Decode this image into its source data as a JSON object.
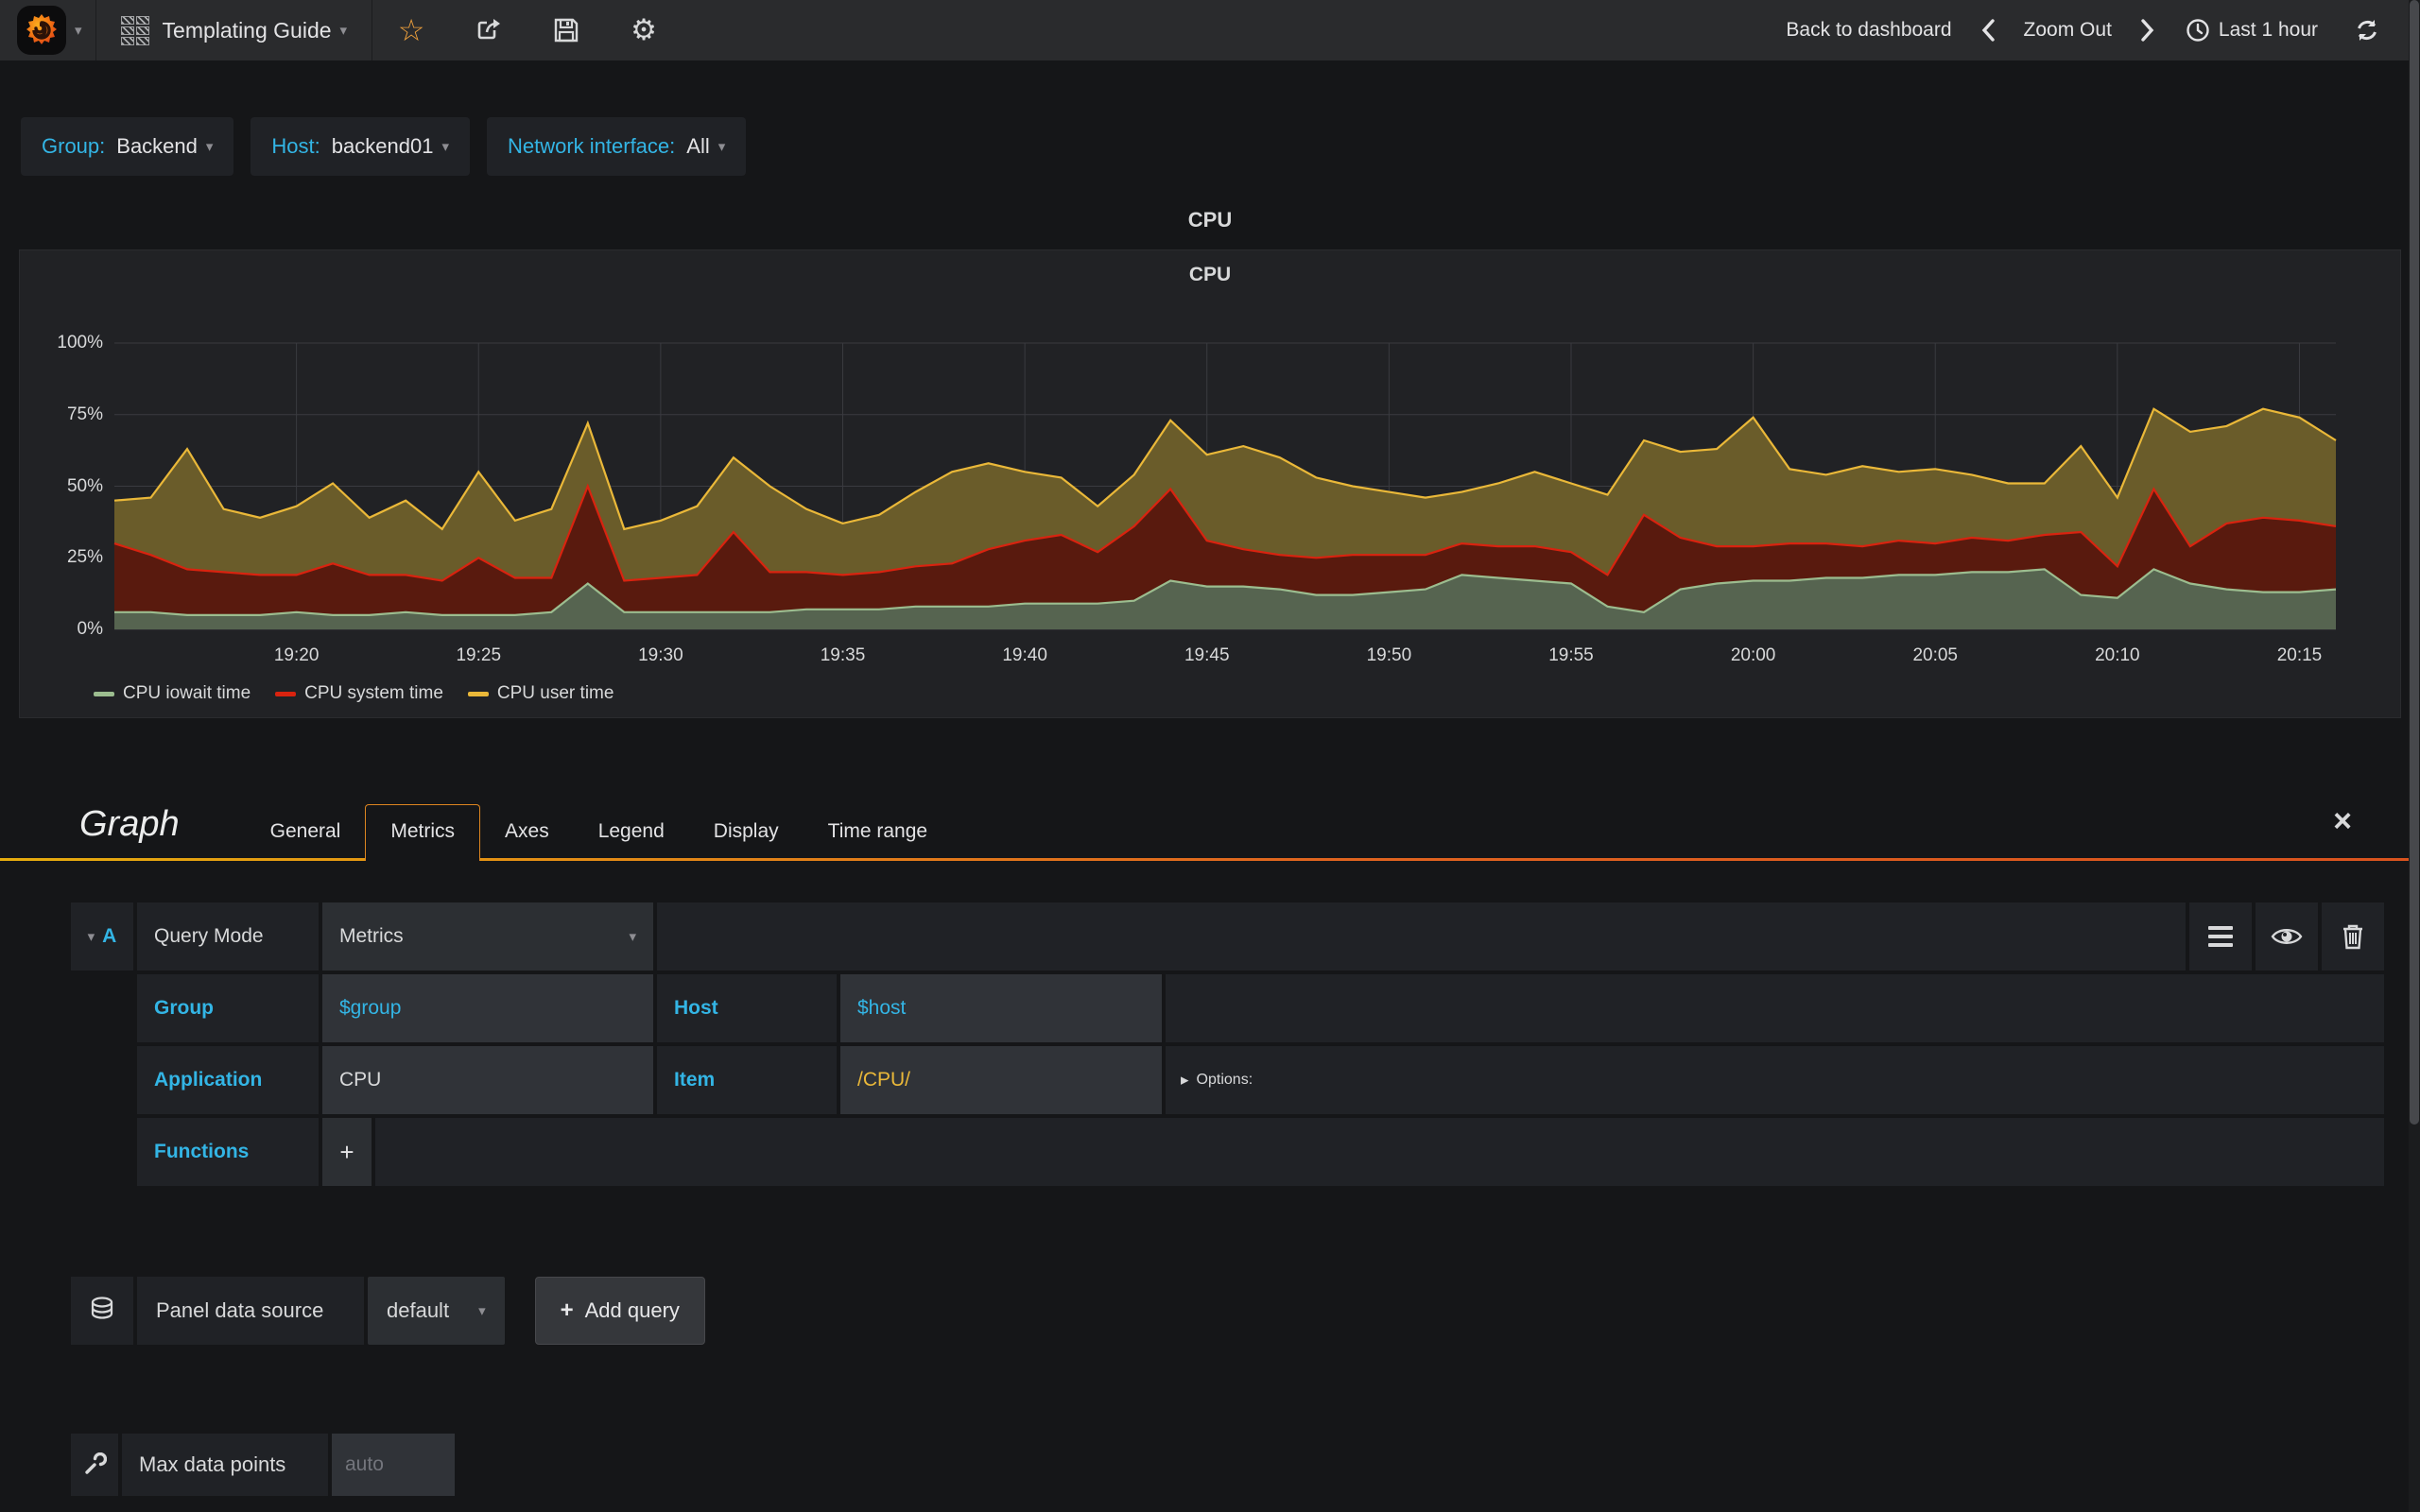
{
  "navbar": {
    "dashboard_title": "Templating Guide",
    "back_to_dashboard": "Back to dashboard",
    "zoom_out": "Zoom Out",
    "time_range": "Last 1 hour"
  },
  "icons": {
    "star": "☆",
    "gear": "⚙",
    "caret_down": "▾",
    "options_caret": "▸",
    "close": "×",
    "plus": "+"
  },
  "variables": [
    {
      "label": "Group:",
      "value": "Backend"
    },
    {
      "label": "Host:",
      "value": "backend01"
    },
    {
      "label": "Network interface:",
      "value": "All"
    }
  ],
  "row_title": "CPU",
  "panel": {
    "title": "CPU"
  },
  "chart_data": {
    "type": "area",
    "stacked": true,
    "title": "CPU",
    "ylabel": "",
    "xlabel": "",
    "ylim": [
      0,
      100
    ],
    "y_ticks": [
      "100%",
      "75%",
      "50%",
      "25%",
      "0%"
    ],
    "grid": true,
    "legend_position": "bottom-left",
    "x": [
      "19:15",
      "19:16",
      "19:17",
      "19:18",
      "19:19",
      "19:20",
      "19:21",
      "19:22",
      "19:23",
      "19:24",
      "19:25",
      "19:26",
      "19:27",
      "19:28",
      "19:29",
      "19:30",
      "19:31",
      "19:32",
      "19:33",
      "19:34",
      "19:35",
      "19:36",
      "19:37",
      "19:38",
      "19:39",
      "19:40",
      "19:41",
      "19:42",
      "19:43",
      "19:44",
      "19:45",
      "19:46",
      "19:47",
      "19:48",
      "19:49",
      "19:50",
      "19:51",
      "19:52",
      "19:53",
      "19:54",
      "19:55",
      "19:56",
      "19:57",
      "19:58",
      "19:59",
      "20:00",
      "20:01",
      "20:02",
      "20:03",
      "20:04",
      "20:05",
      "20:06",
      "20:07",
      "20:08",
      "20:09",
      "20:10",
      "20:11",
      "20:12",
      "20:13",
      "20:14",
      "20:15",
      "20:16"
    ],
    "x_tick_labels": [
      "19:20",
      "19:25",
      "19:30",
      "19:35",
      "19:40",
      "19:45",
      "19:50",
      "19:55",
      "20:00",
      "20:05",
      "20:10",
      "20:15"
    ],
    "x_tick_indices": [
      5,
      10,
      15,
      20,
      25,
      30,
      35,
      40,
      45,
      50,
      55,
      60
    ],
    "series": [
      {
        "name": "CPU iowait time",
        "color": "#9cbd8f",
        "fill": "#566450",
        "values": [
          6,
          6,
          5,
          5,
          5,
          6,
          5,
          5,
          6,
          5,
          5,
          5,
          6,
          16,
          6,
          6,
          6,
          6,
          6,
          7,
          7,
          7,
          8,
          8,
          8,
          9,
          9,
          9,
          10,
          17,
          15,
          15,
          14,
          12,
          12,
          13,
          14,
          19,
          18,
          17,
          16,
          8,
          6,
          14,
          16,
          17,
          17,
          18,
          18,
          19,
          19,
          20,
          20,
          21,
          12,
          11,
          21,
          16,
          14,
          13,
          13,
          14
        ]
      },
      {
        "name": "CPU system time",
        "color": "#d9230f",
        "fill": "#591a0e",
        "values": [
          24,
          20,
          16,
          15,
          14,
          13,
          18,
          14,
          13,
          12,
          20,
          13,
          12,
          34,
          11,
          12,
          13,
          28,
          14,
          13,
          12,
          13,
          14,
          15,
          20,
          22,
          24,
          18,
          26,
          32,
          16,
          13,
          12,
          13,
          14,
          13,
          12,
          11,
          11,
          12,
          11,
          11,
          34,
          18,
          13,
          12,
          13,
          12,
          11,
          12,
          11,
          12,
          11,
          12,
          22,
          11,
          28,
          13,
          23,
          26,
          25,
          22
        ]
      },
      {
        "name": "CPU user time",
        "color": "#EAB839",
        "fill": "#6a5c2a",
        "values": [
          15,
          20,
          42,
          22,
          20,
          24,
          28,
          20,
          26,
          18,
          30,
          20,
          24,
          22,
          18,
          20,
          24,
          26,
          30,
          22,
          18,
          20,
          26,
          32,
          30,
          24,
          20,
          16,
          18,
          24,
          30,
          36,
          34,
          28,
          24,
          22,
          20,
          18,
          22,
          26,
          24,
          28,
          26,
          30,
          34,
          45,
          26,
          24,
          28,
          24,
          26,
          22,
          20,
          18,
          30,
          24,
          28,
          40,
          34,
          38,
          36,
          30
        ]
      }
    ]
  },
  "editor": {
    "title": "Graph",
    "tabs": [
      {
        "label": "General"
      },
      {
        "label": "Metrics"
      },
      {
        "label": "Axes"
      },
      {
        "label": "Legend"
      },
      {
        "label": "Display"
      },
      {
        "label": "Time range"
      }
    ],
    "query": {
      "ref": "A",
      "query_mode_label": "Query Mode",
      "query_mode_value": "Metrics",
      "group_label": "Group",
      "group_value": "$group",
      "host_label": "Host",
      "host_value": "$host",
      "application_label": "Application",
      "application_value": "CPU",
      "item_label": "Item",
      "item_value": "/CPU/",
      "options_label": "Options:",
      "functions_label": "Functions"
    },
    "datasource": {
      "label": "Panel data source",
      "value": "default",
      "add_query": "Add query"
    },
    "max_data_points": {
      "label": "Max data points",
      "placeholder": "auto"
    }
  }
}
